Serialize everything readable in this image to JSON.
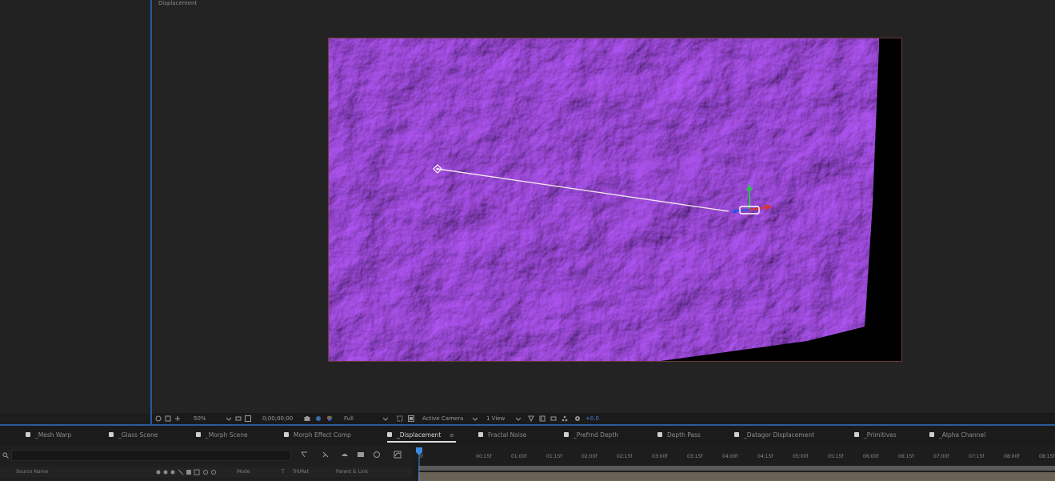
{
  "viewer": {
    "tab_label": "Displacement",
    "toolbar": {
      "zoom": "50%",
      "timecode": "0;00;00;00",
      "resolution": "Full",
      "camera": "Active Camera",
      "views": "1 View",
      "exposure": "+0.0"
    }
  },
  "comp_tabs": [
    {
      "label": "_Mesh Warp"
    },
    {
      "label": "_Glass Scene"
    },
    {
      "label": "_Morph Scene"
    },
    {
      "label": "Morph Effect Comp"
    },
    {
      "label": "_Displacement",
      "active": true
    },
    {
      "label": "Fractal Noise"
    },
    {
      "label": "_Prefrnd Depth"
    },
    {
      "label": "Depth Pass"
    },
    {
      "label": "_Datagor Displacement"
    },
    {
      "label": "_Primitives"
    },
    {
      "label": "_Alpha Channel"
    }
  ],
  "timeline": {
    "columns": {
      "name": "Source Name",
      "mode": "Mode",
      "track": "T",
      "trkmat": "TrkMat",
      "parent": "Parent & Link"
    },
    "ruler_ticks": [
      "0f",
      "00:15f",
      "01:00f",
      "01:15f",
      "02:00f",
      "02:15f",
      "03:00f",
      "03:15f",
      "04:00f",
      "04:15f",
      "05:00f",
      "05:15f",
      "06:00f",
      "06:15f",
      "07:00f",
      "07:15f",
      "08:00f",
      "08:15f",
      "09:00f"
    ]
  },
  "colors": {
    "accent_blue": "#2b5a9a",
    "texture_purple": "#8a2bc6",
    "playhead": "#3b8bdc"
  }
}
